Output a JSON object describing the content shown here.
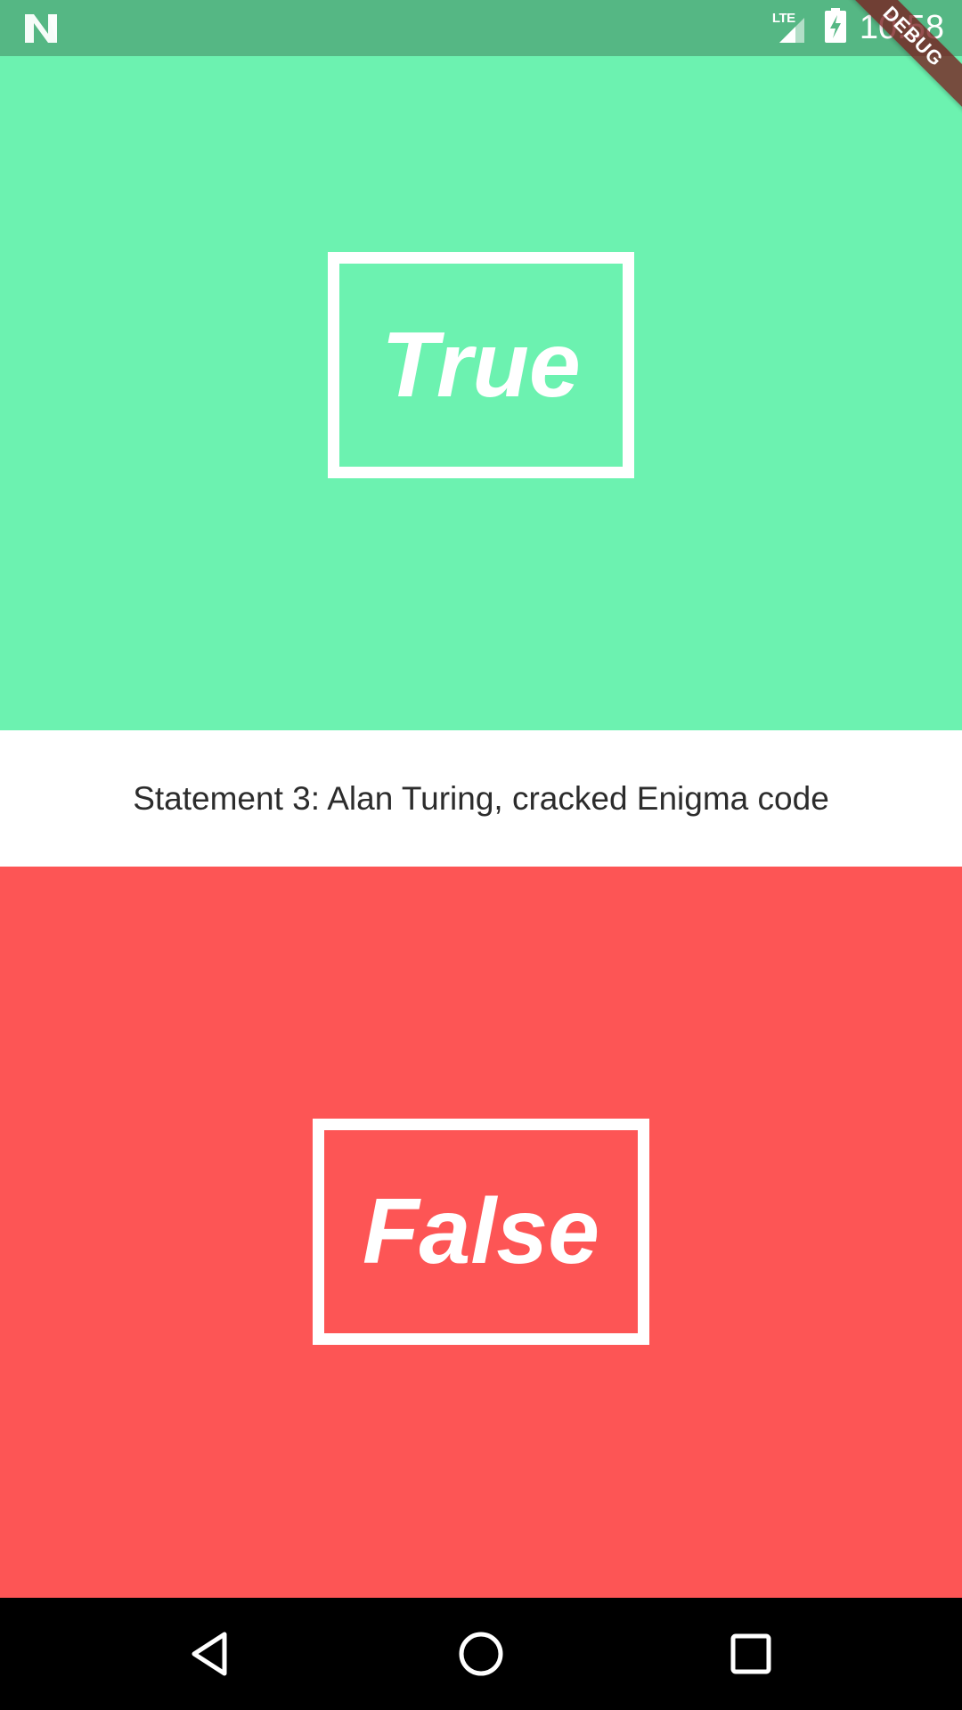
{
  "status_bar": {
    "network_label": "LTE",
    "time": "10:58",
    "icons": {
      "left": "n-logo-icon",
      "signal": "signal-icon",
      "battery": "battery-charging-icon"
    }
  },
  "debug_banner": "DEBUG",
  "quiz": {
    "true_label": "True",
    "false_label": "False",
    "statement": "Statement 3: Alan Turing, cracked Enigma code"
  },
  "colors": {
    "status_bar": "#55b784",
    "true_panel": "#6cf2b0",
    "false_panel": "#fd5555",
    "statement_bg": "#ffffff"
  },
  "nav_bar": {
    "icons": [
      "back-icon",
      "home-icon",
      "recents-icon"
    ]
  }
}
